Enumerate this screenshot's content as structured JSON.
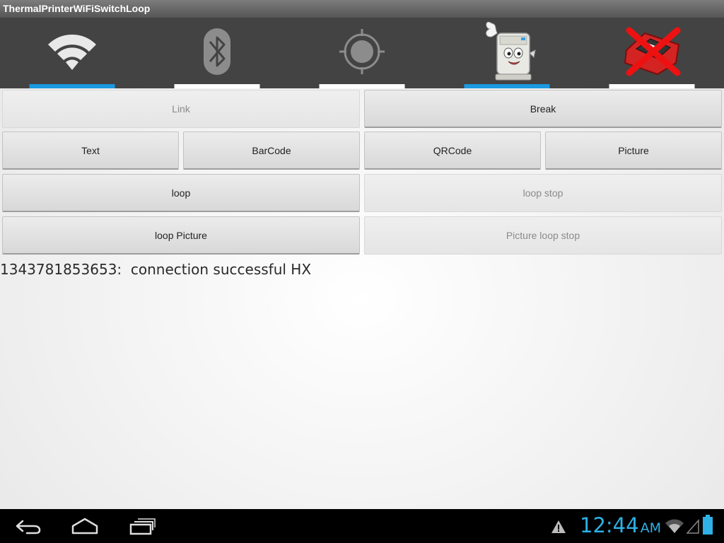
{
  "window": {
    "title": "ThermalPrinterWiFiSwitchLoop"
  },
  "tabs": [
    {
      "icon": "wifi-icon",
      "active": true
    },
    {
      "icon": "bluetooth-icon",
      "active": false
    },
    {
      "icon": "gps-icon",
      "active": false
    },
    {
      "icon": "printer-mascot-icon",
      "active": true
    },
    {
      "icon": "device-crossed-out-icon",
      "active": false
    }
  ],
  "buttons": {
    "link": "Link",
    "break": "Break",
    "text": "Text",
    "barcode": "BarCode",
    "qrcode": "QRCode",
    "picture": "Picture",
    "loop": "loop",
    "loop_stop": "loop stop",
    "loop_picture": "loop Picture",
    "picture_loop_stop": "Picture loop stop"
  },
  "status": {
    "message": "1343781853653:  connection successful HX"
  },
  "system_bar": {
    "time": "12:44",
    "ampm": "AM",
    "accent_color": "#2fb1e6"
  }
}
